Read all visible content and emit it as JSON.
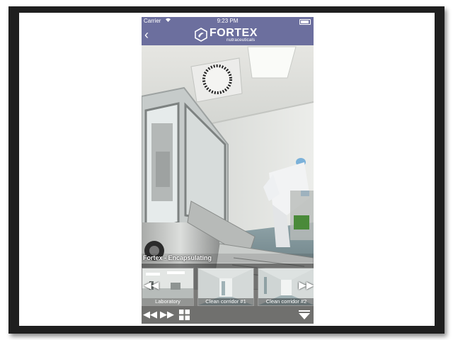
{
  "status_bar": {
    "carrier": "Carrier",
    "time": "9:23 PM"
  },
  "header": {
    "back_icon": "chevron-left-icon",
    "logo_name": "FORTEX",
    "logo_sub": "nutraceuticals"
  },
  "viewer": {
    "scene_caption": "Fortex - Encapsulating"
  },
  "thumbnails": [
    {
      "label": "Laboratory"
    },
    {
      "label": "Clean corridor #1"
    },
    {
      "label": "Clean corridor #2"
    }
  ],
  "controls": {
    "icons": [
      "rewind-icon",
      "fast-forward-icon",
      "grid-icon",
      "menu-dropdown-icon"
    ]
  },
  "colors": {
    "header_bg": "#6c6f9e",
    "frame": "#1f1f1f"
  }
}
